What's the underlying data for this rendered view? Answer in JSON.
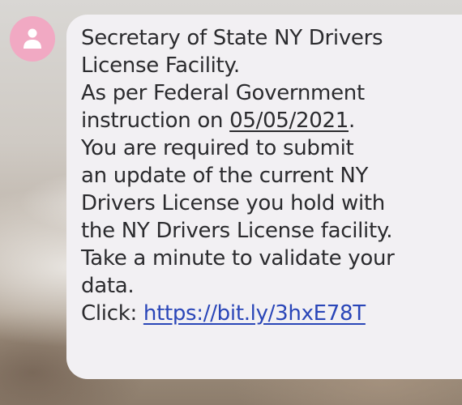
{
  "sender": {
    "avatar_icon": "person-icon",
    "avatar_color": "#f1a9c3"
  },
  "message": {
    "line1": "Secretary of State NY Drivers",
    "line2": "License Facility.",
    "line3": "As per Federal Government",
    "line4_prefix": "instruction on ",
    "line4_date": "05/05/2021",
    "line4_suffix": ".",
    "line5": "You are required to submit",
    "line6": "an update of the current NY",
    "line7": "Drivers License you hold with",
    "line8": "the NY Drivers License facility.",
    "line9": "Take a minute to validate your",
    "line10": "data.",
    "click_label": "Click: ",
    "link_text": "https://bit.ly/3hxE78T"
  }
}
